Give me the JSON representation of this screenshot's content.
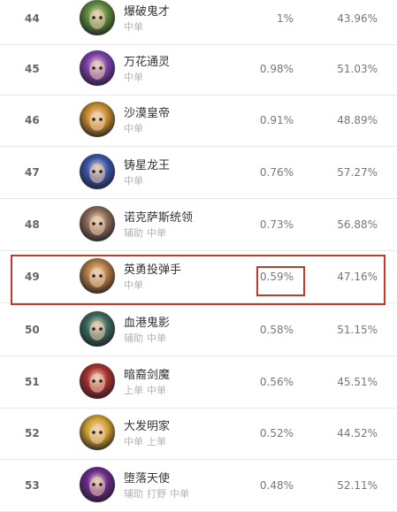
{
  "rows": [
    {
      "rank": "44",
      "name": "爆破鬼才",
      "roles": [
        "中单"
      ],
      "pick_rate": "1%",
      "win_rate": "43.96%",
      "color": "#5a8a3a"
    },
    {
      "rank": "45",
      "name": "万花通灵",
      "roles": [
        "中单"
      ],
      "pick_rate": "0.98%",
      "win_rate": "51.03%",
      "color": "#7b3fa8"
    },
    {
      "rank": "46",
      "name": "沙漠皇帝",
      "roles": [
        "中单"
      ],
      "pick_rate": "0.91%",
      "win_rate": "48.89%",
      "color": "#c58a2c"
    },
    {
      "rank": "47",
      "name": "铸星龙王",
      "roles": [
        "中单"
      ],
      "pick_rate": "0.76%",
      "win_rate": "57.27%",
      "color": "#3a55a8"
    },
    {
      "rank": "48",
      "name": "诺克萨斯统领",
      "roles": [
        "辅助",
        "中单"
      ],
      "pick_rate": "0.73%",
      "win_rate": "56.88%",
      "color": "#8a6a55"
    },
    {
      "rank": "49",
      "name": "英勇投弹手",
      "roles": [
        "中单"
      ],
      "pick_rate": "0.59%",
      "win_rate": "47.16%",
      "color": "#b07a40"
    },
    {
      "rank": "50",
      "name": "血港鬼影",
      "roles": [
        "辅助",
        "中单"
      ],
      "pick_rate": "0.58%",
      "win_rate": "51.15%",
      "color": "#3a6a5a"
    },
    {
      "rank": "51",
      "name": "暗裔剑魔",
      "roles": [
        "上单",
        "中单"
      ],
      "pick_rate": "0.56%",
      "win_rate": "45.51%",
      "color": "#a83030"
    },
    {
      "rank": "52",
      "name": "大发明家",
      "roles": [
        "中单",
        "上单"
      ],
      "pick_rate": "0.52%",
      "win_rate": "44.52%",
      "color": "#d0a030"
    },
    {
      "rank": "53",
      "name": "堕落天使",
      "roles": [
        "辅助",
        "打野",
        "中单"
      ],
      "pick_rate": "0.48%",
      "win_rate": "52.11%",
      "color": "#6a2a8a"
    }
  ],
  "highlight": {
    "row_rank": "49",
    "cell": "pick_rate",
    "color": "#c0392b"
  }
}
